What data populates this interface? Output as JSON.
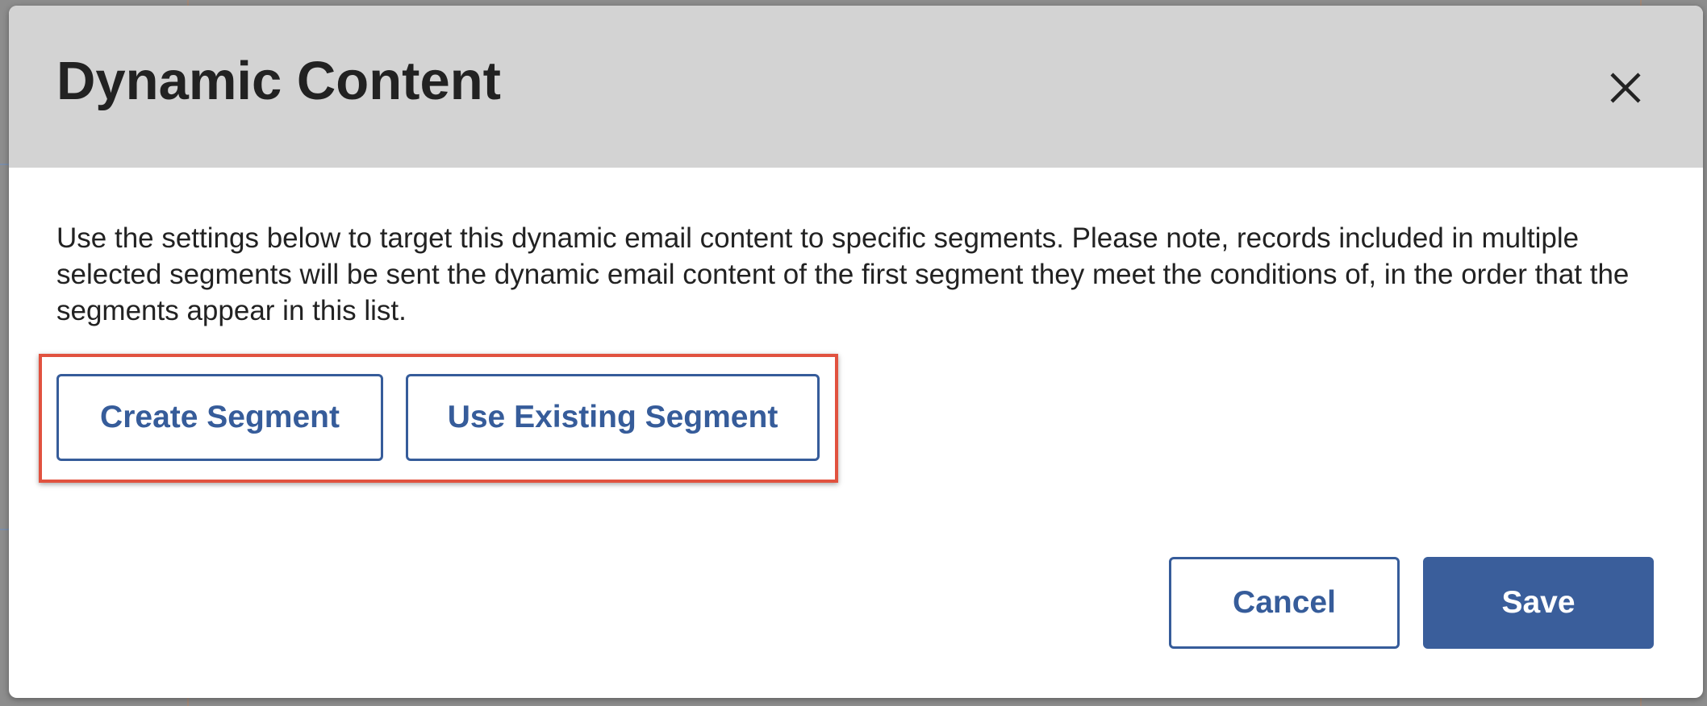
{
  "dialog": {
    "title": "Dynamic Content",
    "close_label": "close",
    "description": "Use the settings below to target this dynamic email content to specific segments. Please note, records included in multiple selected segments will be sent the dynamic email content of the first segment they meet the conditions of, in the order that the segments appear in this list.",
    "segment_actions": {
      "create_label": "Create Segment",
      "existing_label": "Use Existing Segment"
    },
    "footer": {
      "cancel_label": "Cancel",
      "save_label": "Save"
    }
  },
  "icons": {
    "close": "close-icon"
  },
  "colors": {
    "header_bg": "#d3d3d3",
    "accent": "#3a5e9b",
    "highlight": "#e1523f",
    "title_text": "#222222"
  }
}
